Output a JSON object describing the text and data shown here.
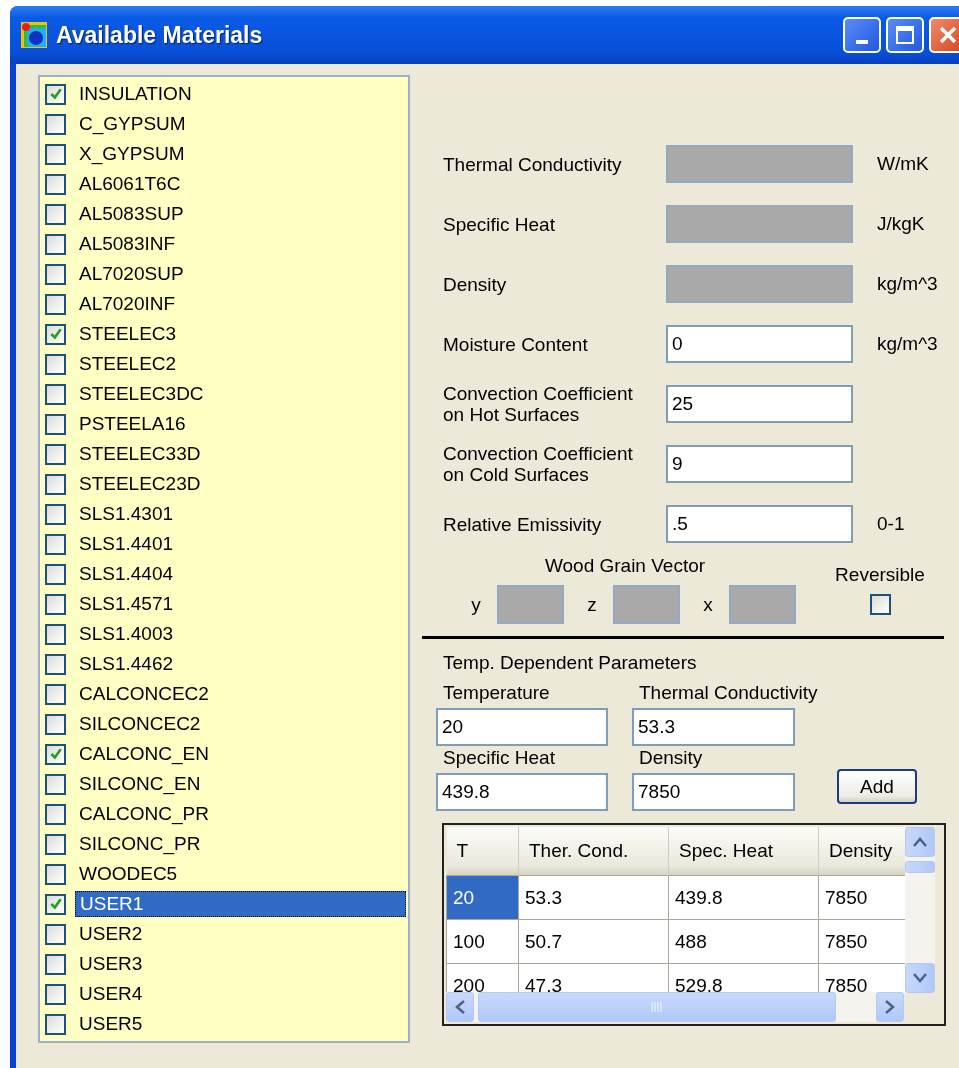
{
  "window": {
    "title": "Available Materials"
  },
  "materials": [
    {
      "name": "INSULATION",
      "checked": true,
      "selected": false
    },
    {
      "name": "C_GYPSUM",
      "checked": false,
      "selected": false
    },
    {
      "name": "X_GYPSUM",
      "checked": false,
      "selected": false
    },
    {
      "name": "AL6061T6C",
      "checked": false,
      "selected": false
    },
    {
      "name": "AL5083SUP",
      "checked": false,
      "selected": false
    },
    {
      "name": "AL5083INF",
      "checked": false,
      "selected": false
    },
    {
      "name": "AL7020SUP",
      "checked": false,
      "selected": false
    },
    {
      "name": "AL7020INF",
      "checked": false,
      "selected": false
    },
    {
      "name": "STEELEC3",
      "checked": true,
      "selected": false
    },
    {
      "name": "STEELEC2",
      "checked": false,
      "selected": false
    },
    {
      "name": "STEELEC3DC",
      "checked": false,
      "selected": false
    },
    {
      "name": "PSTEELA16",
      "checked": false,
      "selected": false
    },
    {
      "name": "STEELEC33D",
      "checked": false,
      "selected": false
    },
    {
      "name": "STEELEC23D",
      "checked": false,
      "selected": false
    },
    {
      "name": "SLS1.4301",
      "checked": false,
      "selected": false
    },
    {
      "name": "SLS1.4401",
      "checked": false,
      "selected": false
    },
    {
      "name": "SLS1.4404",
      "checked": false,
      "selected": false
    },
    {
      "name": "SLS1.4571",
      "checked": false,
      "selected": false
    },
    {
      "name": "SLS1.4003",
      "checked": false,
      "selected": false
    },
    {
      "name": "SLS1.4462",
      "checked": false,
      "selected": false
    },
    {
      "name": "CALCONCEC2",
      "checked": false,
      "selected": false
    },
    {
      "name": "SILCONCEC2",
      "checked": false,
      "selected": false
    },
    {
      "name": "CALCONC_EN",
      "checked": true,
      "selected": false
    },
    {
      "name": "SILCONC_EN",
      "checked": false,
      "selected": false
    },
    {
      "name": "CALCONC_PR",
      "checked": false,
      "selected": false
    },
    {
      "name": "SILCONC_PR",
      "checked": false,
      "selected": false
    },
    {
      "name": "WOODEC5",
      "checked": false,
      "selected": false
    },
    {
      "name": "USER1",
      "checked": true,
      "selected": true
    },
    {
      "name": "USER2",
      "checked": false,
      "selected": false
    },
    {
      "name": "USER3",
      "checked": false,
      "selected": false
    },
    {
      "name": "USER4",
      "checked": false,
      "selected": false
    },
    {
      "name": "USER5",
      "checked": false,
      "selected": false
    }
  ],
  "properties": [
    {
      "label": "Thermal Conductivity",
      "unit": "W/mK",
      "disabled": true
    },
    {
      "label": "Specific Heat",
      "unit": "J/kgK",
      "disabled": true
    },
    {
      "label": "Density",
      "unit": "kg/m^3",
      "disabled": true
    },
    {
      "label": "Moisture Content",
      "value": "0",
      "unit": "kg/m^3",
      "disabled": false
    },
    {
      "label": "Convection Coefficient\non Hot Surfaces",
      "value": "25",
      "disabled": false
    },
    {
      "label": "Convection Coefficient\non Cold Surfaces",
      "value": "9",
      "disabled": false
    },
    {
      "label": "Relative Emissivity",
      "value": ".5",
      "unit": "0-1",
      "disabled": false
    }
  ],
  "wood_grain": {
    "title": "Wood Grain Vector",
    "axes": [
      {
        "label": "y",
        "disabled": true
      },
      {
        "label": "z",
        "disabled": true
      },
      {
        "label": "x",
        "disabled": true
      }
    ]
  },
  "reversible": {
    "label": "Reversible",
    "checked": false
  },
  "temp_params": {
    "title": "Temp. Dependent Parameters",
    "fields": [
      {
        "label": "Temperature",
        "value": "20"
      },
      {
        "label": "Thermal Conductivity",
        "value": "53.3"
      },
      {
        "label": "Specific Heat",
        "value": "439.8"
      },
      {
        "label": "Density",
        "value": "7850"
      }
    ],
    "add_button": "Add"
  },
  "table": {
    "columns": [
      "T",
      "Ther. Cond.",
      "Spec. Heat",
      "Density"
    ],
    "rows": [
      {
        "cells": [
          "20",
          "53.3",
          "439.8",
          "7850"
        ],
        "selected": true
      },
      {
        "cells": [
          "100",
          "50.7",
          "488",
          "7850"
        ],
        "selected": false
      },
      {
        "cells": [
          "200",
          "47.3",
          "529.8",
          "7850"
        ],
        "selected": false
      }
    ]
  }
}
